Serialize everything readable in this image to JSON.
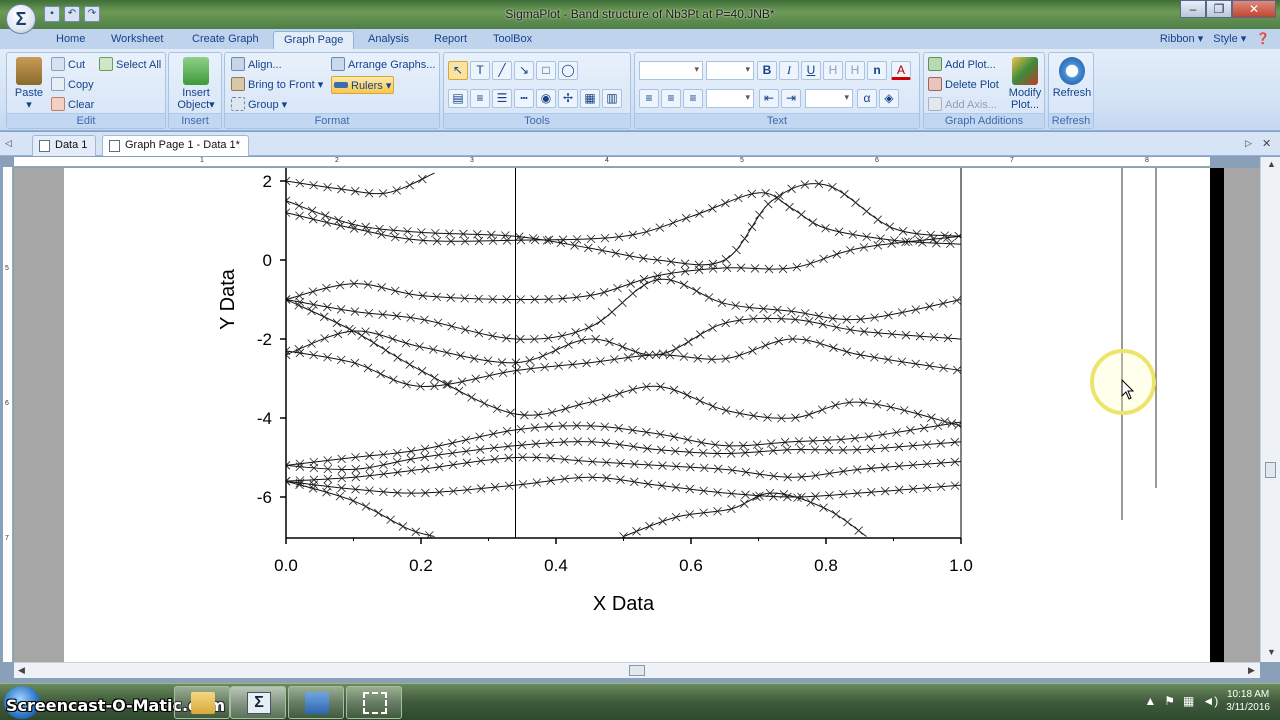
{
  "window": {
    "title": "SigmaPlot - Band structure of Nb3Pt at P=40.JNB*"
  },
  "ribbon_tabs": [
    "Home",
    "Worksheet",
    "Create Graph",
    "Graph Page",
    "Analysis",
    "Report",
    "ToolBox"
  ],
  "active_tab": "Graph Page",
  "ribbon_right": {
    "ribbon_label": "Ribbon",
    "style_label": "Style"
  },
  "groups": {
    "edit": {
      "label": "Edit",
      "paste": "Paste",
      "cut": "Cut",
      "copy": "Copy",
      "clear": "Clear",
      "select_all": "Select All"
    },
    "insert": {
      "label": "Insert",
      "insert_object": "Insert",
      "insert_object_2": "Object"
    },
    "format": {
      "label": "Format",
      "align": "Align...",
      "bring_to_front": "Bring to Front",
      "group": "Group",
      "arrange_graphs": "Arrange Graphs...",
      "rulers": "Rulers"
    },
    "tools": {
      "label": "Tools"
    },
    "text": {
      "label": "Text",
      "bold": "B",
      "italic": "I",
      "underline": "U",
      "superscript": "H",
      "subscript": "H",
      "n": "n",
      "alpha": "α"
    },
    "graph_additions": {
      "label": "Graph Additions",
      "add_plot": "Add Plot...",
      "delete_plot": "Delete Plot",
      "add_axis": "Add Axis...",
      "modify_plot": "Modify",
      "modify_plot_2": "Plot..."
    },
    "refresh": {
      "label": "Refresh",
      "refresh": "Refresh"
    }
  },
  "doc_tabs": [
    "Data 1",
    "Graph Page 1 - Data 1*"
  ],
  "ruler_h_labels": [
    "1",
    "2",
    "3",
    "4",
    "5",
    "6",
    "7",
    "8"
  ],
  "ruler_v_labels": [
    "5",
    "6",
    "7"
  ],
  "taskbar": {
    "watermark": "Screencast-O-Matic.com",
    "time": "10:18 AM",
    "date": "3/11/2016"
  },
  "chart_data": {
    "type": "line",
    "xlabel": "X Data",
    "ylabel": "Y Data",
    "xlim": [
      0.0,
      1.0
    ],
    "ylim": [
      -7,
      2
    ],
    "x_ticks": [
      "0.0",
      "0.2",
      "0.4",
      "0.6",
      "0.8",
      "1.0"
    ],
    "y_ticks": [
      "2",
      "0",
      "-2",
      "-4",
      "-6"
    ],
    "symbol": "x",
    "grid": false,
    "vertical_lines_x": [
      0.34,
      1.0
    ],
    "bands": [
      {
        "x": [
          0,
          0.08,
          0.15,
          0.22
        ],
        "y": [
          2.0,
          1.8,
          1.7,
          2.2
        ]
      },
      {
        "x": [
          0,
          0.1,
          0.2,
          0.34,
          0.5,
          0.6,
          0.7,
          0.75,
          0.8,
          0.9,
          1.0
        ],
        "y": [
          1.2,
          0.8,
          0.5,
          0.5,
          0.6,
          1.1,
          1.7,
          1.3,
          0.8,
          0.5,
          0.4
        ]
      },
      {
        "x": [
          0,
          0.1,
          0.2,
          0.34,
          0.45,
          0.55,
          0.65,
          0.72,
          0.8,
          0.9,
          1.0
        ],
        "y": [
          1.5,
          0.9,
          0.7,
          0.6,
          0.3,
          0.0,
          0.0,
          1.5,
          1.9,
          0.8,
          0.6
        ]
      },
      {
        "x": [
          0,
          0.1,
          0.2,
          0.34,
          0.45,
          0.55,
          0.65,
          0.75,
          0.85,
          1.0
        ],
        "y": [
          -1.0,
          -0.6,
          -0.9,
          -1.0,
          -0.9,
          -0.4,
          -0.2,
          -0.2,
          0.3,
          0.6
        ]
      },
      {
        "x": [
          0,
          0.1,
          0.2,
          0.34,
          0.45,
          0.55,
          0.65,
          0.75,
          0.85,
          1.0
        ],
        "y": [
          -1.0,
          -1.3,
          -1.5,
          -2.0,
          -1.7,
          -0.5,
          -1.1,
          -1.3,
          -1.5,
          -1.0
        ]
      },
      {
        "x": [
          0,
          0.1,
          0.2,
          0.34,
          0.45,
          0.55,
          0.65,
          0.75,
          0.85,
          1.0
        ],
        "y": [
          -2.4,
          -1.8,
          -2.2,
          -2.6,
          -2.0,
          -2.4,
          -1.6,
          -1.5,
          -1.8,
          -2.0
        ]
      },
      {
        "x": [
          0,
          0.1,
          0.2,
          0.34,
          0.45,
          0.55,
          0.65,
          0.75,
          0.85,
          1.0
        ],
        "y": [
          -2.3,
          -2.6,
          -3.2,
          -2.8,
          -2.6,
          -2.4,
          -2.5,
          -2.0,
          -2.4,
          -2.8
        ]
      },
      {
        "x": [
          0,
          0.1,
          0.2,
          0.34,
          0.45,
          0.55,
          0.65,
          0.75,
          0.85,
          1.0
        ],
        "y": [
          -1.0,
          -1.8,
          -2.8,
          -3.9,
          -3.6,
          -3.2,
          -3.8,
          -4.0,
          -3.6,
          -4.2
        ]
      },
      {
        "x": [
          0,
          0.1,
          0.2,
          0.34,
          0.45,
          0.55,
          0.65,
          0.75,
          0.85,
          1.0
        ],
        "y": [
          -5.2,
          -5.0,
          -4.8,
          -4.3,
          -4.2,
          -4.4,
          -4.7,
          -4.6,
          -4.5,
          -4.1
        ]
      },
      {
        "x": [
          0,
          0.1,
          0.2,
          0.34,
          0.45,
          0.55,
          0.65,
          0.75,
          0.85,
          1.0
        ],
        "y": [
          -5.2,
          -5.3,
          -5.0,
          -4.7,
          -4.6,
          -4.8,
          -4.9,
          -4.8,
          -4.8,
          -4.6
        ]
      },
      {
        "x": [
          0,
          0.1,
          0.2,
          0.34,
          0.45,
          0.55,
          0.65,
          0.75,
          0.85,
          1.0
        ],
        "y": [
          -5.6,
          -5.5,
          -5.3,
          -5.0,
          -5.1,
          -5.2,
          -5.3,
          -5.5,
          -5.3,
          -5.1
        ]
      },
      {
        "x": [
          0,
          0.1,
          0.2,
          0.34,
          0.45,
          0.55,
          0.65,
          0.75,
          0.85,
          1.0
        ],
        "y": [
          -5.6,
          -5.8,
          -5.9,
          -5.7,
          -5.5,
          -5.7,
          -5.9,
          -6.0,
          -5.9,
          -5.7
        ]
      },
      {
        "x": [
          0,
          0.1,
          0.18,
          0.22
        ],
        "y": [
          -5.6,
          -6.1,
          -6.8,
          -7.0
        ]
      },
      {
        "x": [
          0.5,
          0.58,
          0.66,
          0.72,
          0.8,
          0.86
        ],
        "y": [
          -7.0,
          -6.5,
          -6.3,
          -5.9,
          -6.3,
          -7.0
        ]
      }
    ]
  }
}
